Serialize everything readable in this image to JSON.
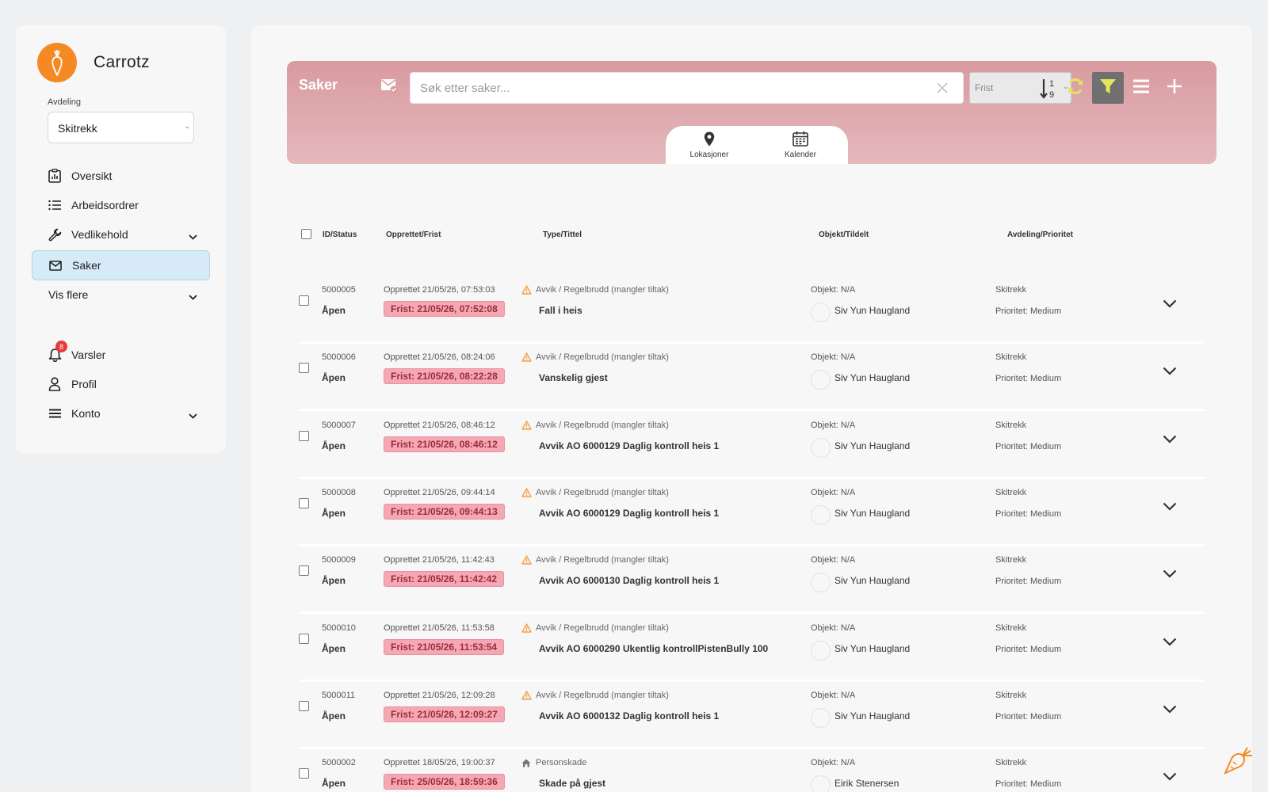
{
  "brand": {
    "name": "Carrotz"
  },
  "department": {
    "label": "Avdeling",
    "selected": "Skitrekk"
  },
  "nav": {
    "items": [
      {
        "label": "Oversikt",
        "icon": "clipboard-chart-icon"
      },
      {
        "label": "Arbeidsordrer",
        "icon": "list-icon"
      },
      {
        "label": "Vedlikehold",
        "icon": "wrench-icon"
      },
      {
        "label": "Saker",
        "icon": "envelope-icon"
      },
      {
        "label": "Vis flere"
      }
    ],
    "bottom": [
      {
        "label": "Varsler",
        "icon": "bell-icon",
        "badge": "8"
      },
      {
        "label": "Profil",
        "icon": "user-icon"
      },
      {
        "label": "Konto",
        "icon": "menu-icon"
      }
    ]
  },
  "header": {
    "title": "Saker",
    "search_placeholder": "Søk etter saker...",
    "sort_label": "Frist",
    "tabs": [
      {
        "label": "Lokasjoner"
      },
      {
        "label": "Kalender"
      }
    ]
  },
  "table": {
    "columns": [
      "ID/Status",
      "Opprettet/Frist",
      "Type/Tittel",
      "Objekt/Tildelt",
      "Avdeling/Prioritet"
    ],
    "rows": [
      {
        "id": "5000005",
        "status": "Åpen",
        "created": "Opprettet 21/05/26, 07:53:03",
        "due": "Frist: 21/05/26, 07:52:08",
        "type": "Avvik / Regelbrudd (mangler tiltak)",
        "title": "Fall i heis",
        "object": "Objekt: N/A",
        "assignee": "Siv Yun Haugland",
        "dept": "Skitrekk",
        "priority": "Prioritet: Medium"
      },
      {
        "id": "5000006",
        "status": "Åpen",
        "created": "Opprettet 21/05/26, 08:24:06",
        "due": "Frist: 21/05/26, 08:22:28",
        "type": "Avvik / Regelbrudd (mangler tiltak)",
        "title": "Vanskelig gjest",
        "object": "Objekt: N/A",
        "assignee": "Siv Yun Haugland",
        "dept": "Skitrekk",
        "priority": "Prioritet: Medium"
      },
      {
        "id": "5000007",
        "status": "Åpen",
        "created": "Opprettet 21/05/26, 08:46:12",
        "due": "Frist: 21/05/26, 08:46:12",
        "type": "Avvik / Regelbrudd (mangler tiltak)",
        "title": "Avvik AO 6000129  Daglig kontroll heis 1",
        "object": "Objekt: N/A",
        "assignee": "Siv Yun Haugland",
        "dept": "Skitrekk",
        "priority": "Prioritet: Medium"
      },
      {
        "id": "5000008",
        "status": "Åpen",
        "created": "Opprettet 21/05/26, 09:44:14",
        "due": "Frist: 21/05/26, 09:44:13",
        "type": "Avvik / Regelbrudd (mangler tiltak)",
        "title": "Avvik AO 6000129  Daglig kontroll heis 1",
        "object": "Objekt: N/A",
        "assignee": "Siv Yun Haugland",
        "dept": "Skitrekk",
        "priority": "Prioritet: Medium"
      },
      {
        "id": "5000009",
        "status": "Åpen",
        "created": "Opprettet 21/05/26, 11:42:43",
        "due": "Frist: 21/05/26, 11:42:42",
        "type": "Avvik / Regelbrudd (mangler tiltak)",
        "title": "Avvik AO 6000130  Daglig kontroll heis 1",
        "object": "Objekt: N/A",
        "assignee": "Siv Yun Haugland",
        "dept": "Skitrekk",
        "priority": "Prioritet: Medium"
      },
      {
        "id": "5000010",
        "status": "Åpen",
        "created": "Opprettet 21/05/26, 11:53:58",
        "due": "Frist: 21/05/26, 11:53:54",
        "type": "Avvik / Regelbrudd (mangler tiltak)",
        "title": "Avvik AO 6000290  Ukentlig kontrollPistenBully 100",
        "object": "Objekt: N/A",
        "assignee": "Siv Yun Haugland",
        "dept": "Skitrekk",
        "priority": "Prioritet: Medium"
      },
      {
        "id": "5000011",
        "status": "Åpen",
        "created": "Opprettet 21/05/26, 12:09:28",
        "due": "Frist: 21/05/26, 12:09:27",
        "type": "Avvik / Regelbrudd (mangler tiltak)",
        "title": "Avvik AO 6000132  Daglig kontroll heis 1",
        "object": "Objekt: N/A",
        "assignee": "Siv Yun Haugland",
        "dept": "Skitrekk",
        "priority": "Prioritet: Medium"
      },
      {
        "id": "5000002",
        "status": "Åpen",
        "created": "Opprettet 18/05/26, 19:00:37",
        "due": "Frist: 25/05/26, 18:59:36",
        "type": "Personskade",
        "title": "Skade på gjest",
        "object": "Objekt: N/A",
        "assignee": "Eirik Stenersen",
        "dept": "Skitrekk",
        "priority": "Prioritet: Medium"
      }
    ]
  },
  "colors": {
    "accent": "#f58a25",
    "header_gradient_top": "#d99aa0",
    "due_badge": "#f3a8b4",
    "refresh": "#e4e65a",
    "filter_bg": "#707070",
    "active_nav": "#d6eaf8"
  }
}
